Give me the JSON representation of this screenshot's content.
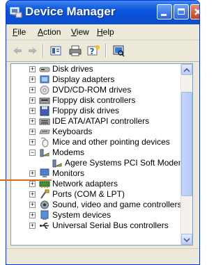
{
  "window": {
    "title": "Device Manager"
  },
  "menu": [
    {
      "accel": "F",
      "rest": "ile"
    },
    {
      "accel": "A",
      "rest": "ction"
    },
    {
      "accel": "V",
      "rest": "iew"
    },
    {
      "accel": "H",
      "rest": "elp"
    }
  ],
  "toolbar": {
    "buttons": [
      "back-arrow",
      "forward-arrow",
      "properties",
      "print",
      "help",
      "scan"
    ]
  },
  "tree": {
    "items": [
      {
        "label": "Disk drives",
        "icon": "disk-drive-icon",
        "expanded": false
      },
      {
        "label": "Display adapters",
        "icon": "display-adapter-icon",
        "expanded": false
      },
      {
        "label": "DVD/CD-ROM drives",
        "icon": "cdrom-icon",
        "expanded": false
      },
      {
        "label": "Floppy disk controllers",
        "icon": "floppy-controller-icon",
        "expanded": false
      },
      {
        "label": "Floppy disk drives",
        "icon": "floppy-drive-icon",
        "expanded": false
      },
      {
        "label": "IDE ATA/ATAPI controllers",
        "icon": "ide-controller-icon",
        "expanded": false
      },
      {
        "label": "Keyboards",
        "icon": "keyboard-icon",
        "expanded": false
      },
      {
        "label": "Mice and other pointing devices",
        "icon": "mouse-icon",
        "expanded": false
      },
      {
        "label": "Modems",
        "icon": "modem-icon",
        "expanded": true
      },
      {
        "label": "Agere Systems PCI Soft Modem",
        "icon": "modem-device-icon",
        "child": true
      },
      {
        "label": "Monitors",
        "icon": "monitor-icon",
        "expanded": false
      },
      {
        "label": "Network adapters",
        "icon": "network-adapter-icon",
        "expanded": false
      },
      {
        "label": "Ports (COM & LPT)",
        "icon": "port-icon",
        "expanded": false
      },
      {
        "label": "Sound, video and game controllers",
        "icon": "sound-icon",
        "expanded": false
      },
      {
        "label": "System devices",
        "icon": "system-devices-icon",
        "expanded": false
      },
      {
        "label": "Universal Serial Bus controllers",
        "icon": "usb-icon",
        "expanded": false
      }
    ]
  },
  "colors": {
    "titlebar": "#0a4fd5",
    "close_button": "#c5401c",
    "connector": "#d96c1a"
  }
}
